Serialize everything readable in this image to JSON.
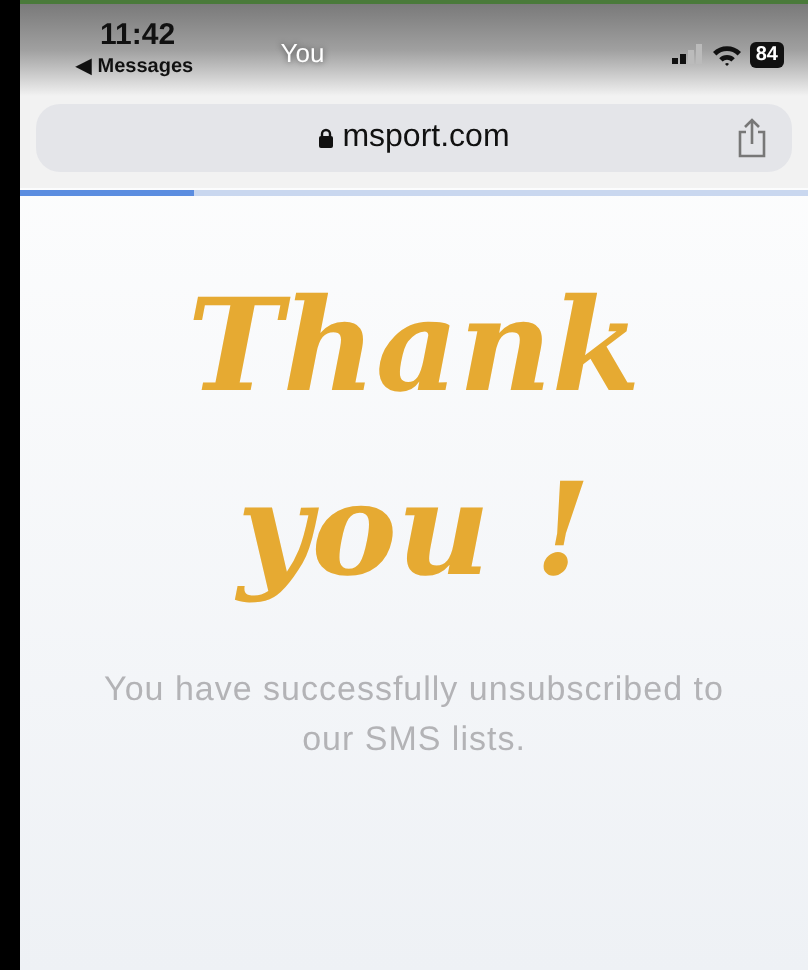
{
  "status_bar": {
    "time": "11:42",
    "back_link": "◀ Messages",
    "center_label": "You",
    "battery": "84"
  },
  "address_bar": {
    "url": "msport.com"
  },
  "load_progress": {
    "level": 0.22
  },
  "page": {
    "heading_lines": [
      "Thank",
      "you !"
    ],
    "message": "You have successfully unsubscribed to our SMS lists."
  }
}
